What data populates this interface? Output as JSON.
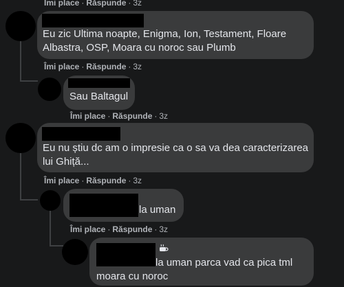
{
  "actions": {
    "like": "Îmi place",
    "reply": "Răspunde",
    "sep": "·"
  },
  "comments": [
    {
      "time": "3z"
    },
    {
      "text_line1": "Eu zic Ultima noapte, Enigma, Ion, Testament, Floare",
      "text_line2": "Albastra, OSP, Moara cu noroc sau Plumb",
      "time": "3z"
    },
    {
      "text_line1": "Sau Baltagul",
      "time": "3z"
    },
    {
      "text_line1": "Eu nu știu dc am o impresie ca o sa va dea caracterizarea",
      "text_line2": "lui Ghiță...",
      "time": "3z"
    },
    {
      "text_line1": "la uman",
      "time": "3z"
    },
    {
      "text_line1": "la uman parca vad ca pica tml",
      "text_line2": "moara cu noroc"
    }
  ],
  "icons": {
    "badge": "coffee-cup-icon"
  }
}
